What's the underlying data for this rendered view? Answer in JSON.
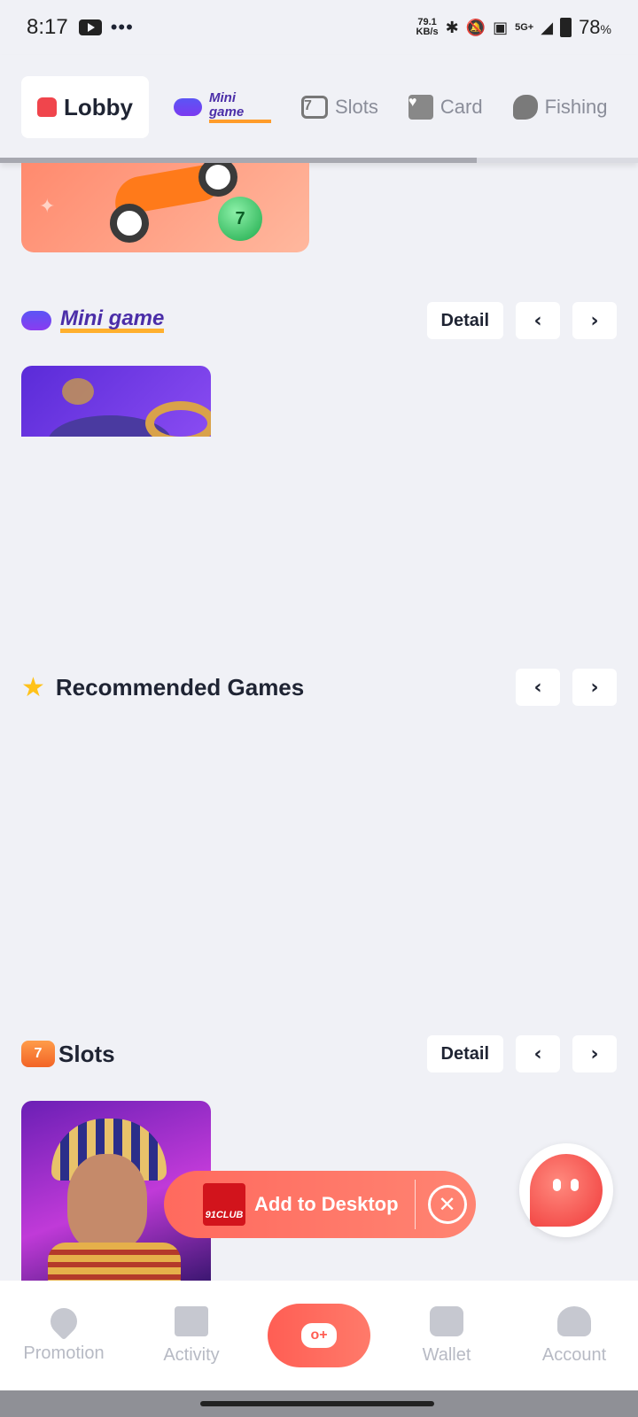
{
  "status_bar": {
    "time": "8:17",
    "net_speed_value": "79.1",
    "net_speed_unit": "KB/s",
    "network": "5G+",
    "battery": "78",
    "battery_unit": "%"
  },
  "tabs": [
    {
      "label": "Lobby",
      "icon": "home-icon",
      "active": true
    },
    {
      "label": "Mini game",
      "icon": "gamepad-icon",
      "active": false
    },
    {
      "label": "Slots",
      "icon": "slot-7-icon",
      "active": false
    },
    {
      "label": "Card",
      "icon": "card-icon",
      "active": false
    },
    {
      "label": "Fishing",
      "icon": "fish-icon",
      "active": false
    }
  ],
  "mini_game": {
    "title": "Mini game",
    "detail_label": "Detail"
  },
  "recommended": {
    "title": "Recommended Games"
  },
  "slots": {
    "title": "Slots",
    "detail_label": "Detail"
  },
  "nav_prev": "‹",
  "nav_next": "›",
  "add_to_desktop": {
    "logo_text": "91CLUB",
    "label": "Add to Desktop"
  },
  "bottom_nav": [
    {
      "label": "Promotion",
      "icon": "promotion-icon"
    },
    {
      "label": "Activity",
      "icon": "gift-icon"
    },
    {
      "label": "",
      "icon": "game-controller-icon"
    },
    {
      "label": "Wallet",
      "icon": "wallet-icon"
    },
    {
      "label": "Account",
      "icon": "account-icon"
    }
  ],
  "colors": {
    "accent": "#ff5e54",
    "background": "#f0f1f6",
    "text": "#1f2433",
    "muted": "#b7bac4"
  }
}
